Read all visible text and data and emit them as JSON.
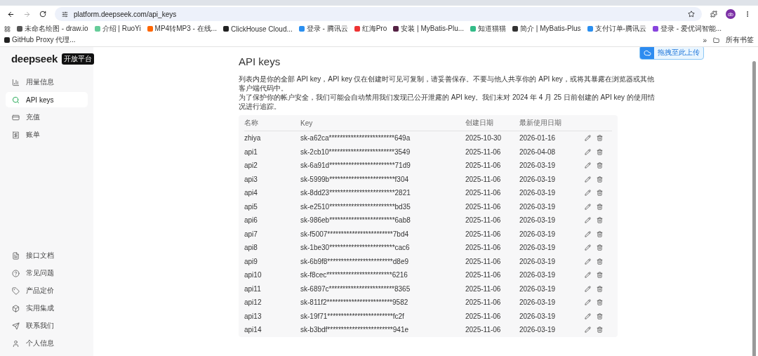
{
  "browser": {
    "url": "platform.deepseek.com/api_keys",
    "avatar": "db",
    "bookmarks": [
      {
        "label": "未命名绘图 - draw.io"
      },
      {
        "label": "介绍 | RuoYi"
      },
      {
        "label": "MP4转MP3 - 在线..."
      },
      {
        "label": "ClickHouse Cloud..."
      },
      {
        "label": "登录 - 腾讯云"
      },
      {
        "label": "红海Pro"
      },
      {
        "label": "安装 | MyBatis-Plu..."
      },
      {
        "label": "知道猫猫"
      },
      {
        "label": "简介 | MyBatis-Plus"
      },
      {
        "label": "支付订单-腾讯云"
      },
      {
        "label": "登录 - 爱优词智能..."
      },
      {
        "label": "GitHub Proxy 代理..."
      }
    ],
    "more": "»",
    "all_bookmarks": "所有书签"
  },
  "upload_widget": {
    "label": "拖拽至此上传"
  },
  "sidebar": {
    "logo": "deepseek",
    "badge": "开放平台",
    "items": [
      {
        "label": "用量信息",
        "selected": false
      },
      {
        "label": "API keys",
        "selected": true
      },
      {
        "label": "充值",
        "selected": false
      },
      {
        "label": "账单",
        "selected": false
      }
    ],
    "bottom_items": [
      {
        "label": "接口文档",
        "selected": false
      },
      {
        "label": "常见问题",
        "selected": false
      },
      {
        "label": "产品定价",
        "selected": false
      },
      {
        "label": "实用集成",
        "selected": false
      },
      {
        "label": "联系我们",
        "selected": false
      },
      {
        "label": "个人信息",
        "selected": false
      }
    ]
  },
  "page": {
    "title": "API keys",
    "description": [
      "列表内是你的全部 API key，API key 仅在创建时可见可复制，请妥善保存。不要与他人共享你的 API key，或将其暴露在浏览器或其他客户端代码中。",
      "为了保护你的帐户安全，我们可能会自动禁用我们发现已公开泄露的 API key。我们未对 2024 年 4 月 25 日前创建的 API key 的使用情况进行追踪。"
    ]
  },
  "table": {
    "columns": [
      "名称",
      "Key",
      "创建日期",
      "最新使用日期"
    ],
    "rows": [
      {
        "name": "zhiya",
        "key": "sk-a62ca************************649a",
        "created": "2025-10-30",
        "last_used": "2026-01-16"
      },
      {
        "name": "api1",
        "key": "sk-2cb10************************3549",
        "created": "2025-11-06",
        "last_used": "2026-04-08"
      },
      {
        "name": "api2",
        "key": "sk-6a91d************************71d9",
        "created": "2025-11-06",
        "last_used": "2026-03-19"
      },
      {
        "name": "api3",
        "key": "sk-5999b************************f304",
        "created": "2025-11-06",
        "last_used": "2026-03-19"
      },
      {
        "name": "api4",
        "key": "sk-8dd23************************2821",
        "created": "2025-11-06",
        "last_used": "2026-03-19"
      },
      {
        "name": "api5",
        "key": "sk-e2510************************bd35",
        "created": "2025-11-06",
        "last_used": "2026-03-19"
      },
      {
        "name": "api6",
        "key": "sk-986eb************************6ab8",
        "created": "2025-11-06",
        "last_used": "2026-03-19"
      },
      {
        "name": "api7",
        "key": "sk-f5007************************7bd4",
        "created": "2025-11-06",
        "last_used": "2026-03-19"
      },
      {
        "name": "api8",
        "key": "sk-1be30************************cac6",
        "created": "2025-11-06",
        "last_used": "2026-03-19"
      },
      {
        "name": "api9",
        "key": "sk-6b9f8************************d8e9",
        "created": "2025-11-06",
        "last_used": "2026-03-19"
      },
      {
        "name": "api10",
        "key": "sk-f8cec************************6216",
        "created": "2025-11-06",
        "last_used": "2026-03-19"
      },
      {
        "name": "api11",
        "key": "sk-6897c************************8365",
        "created": "2025-11-06",
        "last_used": "2026-03-19"
      },
      {
        "name": "api12",
        "key": "sk-811f2************************9582",
        "created": "2025-11-06",
        "last_used": "2026-03-19"
      },
      {
        "name": "api13",
        "key": "sk-19f71************************fc2f",
        "created": "2025-11-06",
        "last_used": "2026-03-19"
      },
      {
        "name": "api14",
        "key": "sk-b3bdf************************941e",
        "created": "2025-11-06",
        "last_used": "2026-03-19"
      }
    ]
  }
}
